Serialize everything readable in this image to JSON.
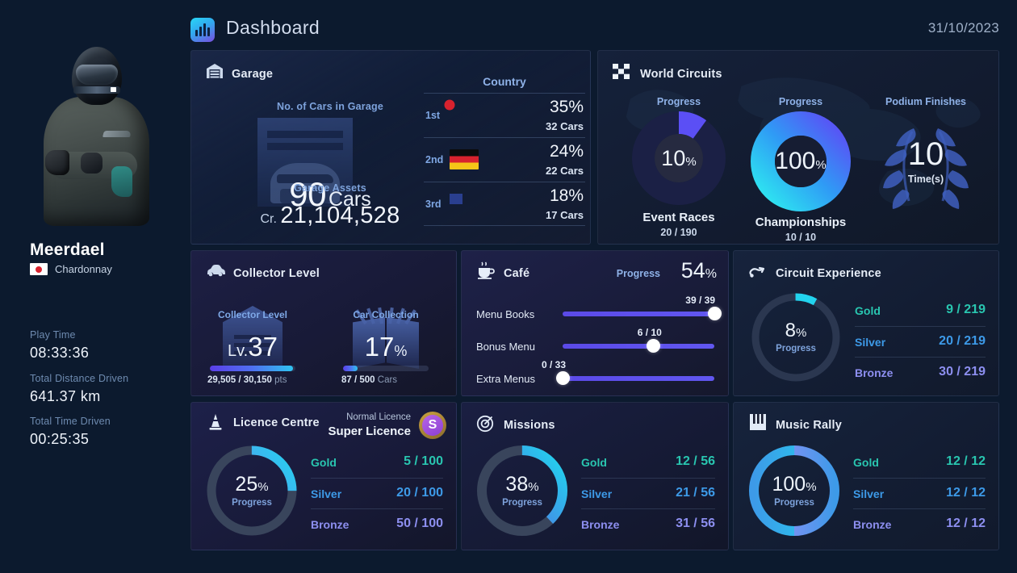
{
  "header": {
    "icon": "bar-chart-icon",
    "title": "Dashboard",
    "date": "31/10/2023"
  },
  "sidebar": {
    "avatar_alt": "racing-driver-avatar",
    "player_name": "Meerdael",
    "team_flag": "jp",
    "team_name": "Chardonnay",
    "stats": [
      {
        "label": "Play Time",
        "value": "08:33:36"
      },
      {
        "label": "Total Distance Driven",
        "value": "641.37 km"
      },
      {
        "label": "Total Time Driven",
        "value": "00:25:35"
      }
    ]
  },
  "garage": {
    "icon": "garage-icon",
    "title": "Garage",
    "cars_label": "No. of Cars in Garage",
    "cars_count": "90",
    "cars_unit": "Cars",
    "assets_label": "Garage Assets",
    "assets_currency": "Cr.",
    "assets_value": "21,104,528",
    "country_header": "Country",
    "countries": [
      {
        "rank": "1st",
        "flag": "jp",
        "percent": "35%",
        "cars": "32 Cars"
      },
      {
        "rank": "2nd",
        "flag": "de",
        "percent": "24%",
        "cars": "22 Cars"
      },
      {
        "rank": "3rd",
        "flag": "us",
        "percent": "18%",
        "cars": "17 Cars"
      }
    ]
  },
  "world_circuits": {
    "icon": "checkered-flag-icon",
    "title": "World Circuits",
    "columns": [
      {
        "cap": "Progress",
        "value": "10",
        "unit": "%",
        "name": "Event Races",
        "frac": "20 / 190"
      },
      {
        "cap": "Progress",
        "value": "100",
        "unit": "%",
        "name": "Championships",
        "frac": "10 / 10"
      },
      {
        "cap": "Podium Finishes",
        "value": "10",
        "unit": "",
        "name": "Time(s)",
        "frac": ""
      }
    ]
  },
  "collector": {
    "icon": "car-icon",
    "title": "Collector Level",
    "tiles": [
      {
        "cap": "Collector Level",
        "prefix": "Lv.",
        "value": "37",
        "suffix": "",
        "bar_caption": "29,505 / 30,150",
        "bar_unit": "pts",
        "fill_pct": 97
      },
      {
        "cap": "Car Collection",
        "prefix": "",
        "value": "17",
        "suffix": "%",
        "bar_caption": "87 / 500",
        "bar_unit": "Cars",
        "fill_pct": 17
      }
    ]
  },
  "cafe": {
    "icon": "coffee-cup-icon",
    "title": "Café",
    "progress_label": "Progress",
    "progress_value": "54",
    "progress_unit": "%",
    "rows": [
      {
        "name": "Menu Books",
        "value": "39 / 39",
        "pos_pct": 100
      },
      {
        "name": "Bonus Menu",
        "value": "6 / 10",
        "pos_pct": 60
      },
      {
        "name": "Extra Menus",
        "value": "0 / 33",
        "pos_pct": 0
      }
    ]
  },
  "circuit_experience": {
    "icon": "circuit-track-icon",
    "title": "Circuit Experience",
    "percent": "8",
    "percent_unit": "%",
    "progress_label": "Progress",
    "arc_pct": 8,
    "medals": [
      {
        "name": "Gold",
        "value": "9 / 219"
      },
      {
        "name": "Silver",
        "value": "20 / 219"
      },
      {
        "name": "Bronze",
        "value": "30 / 219"
      }
    ]
  },
  "licence": {
    "icon": "cone-icon",
    "title": "Licence Centre",
    "normal_label": "Normal Licence",
    "super_label": "Super Licence",
    "badge_letter": "S",
    "percent": "25",
    "percent_unit": "%",
    "progress_label": "Progress",
    "arc_pct": 25,
    "medals": [
      {
        "name": "Gold",
        "value": "5 / 100"
      },
      {
        "name": "Silver",
        "value": "20 / 100"
      },
      {
        "name": "Bronze",
        "value": "50 / 100"
      }
    ]
  },
  "missions": {
    "icon": "target-icon",
    "title": "Missions",
    "percent": "38",
    "percent_unit": "%",
    "progress_label": "Progress",
    "arc_pct": 38,
    "medals": [
      {
        "name": "Gold",
        "value": "12 / 56"
      },
      {
        "name": "Silver",
        "value": "21 / 56"
      },
      {
        "name": "Bronze",
        "value": "31 / 56"
      }
    ]
  },
  "music_rally": {
    "icon": "piano-keys-icon",
    "title": "Music Rally",
    "percent": "100",
    "percent_unit": "%",
    "progress_label": "Progress",
    "arc_pct": 100,
    "medals": [
      {
        "name": "Gold",
        "value": "12 / 12"
      },
      {
        "name": "Silver",
        "value": "12 / 12"
      },
      {
        "name": "Bronze",
        "value": "12 / 12"
      }
    ]
  },
  "colors": {
    "bg": "#0c1a2e",
    "accent_blue": "#7ea3dc",
    "gold": "#29c6b0",
    "silver": "#3d9ae8",
    "bronze": "#8d8ff0",
    "slider": "#6157f0",
    "arc_purple": "#a78bfa",
    "arc_cyan": "#22d3ee"
  }
}
